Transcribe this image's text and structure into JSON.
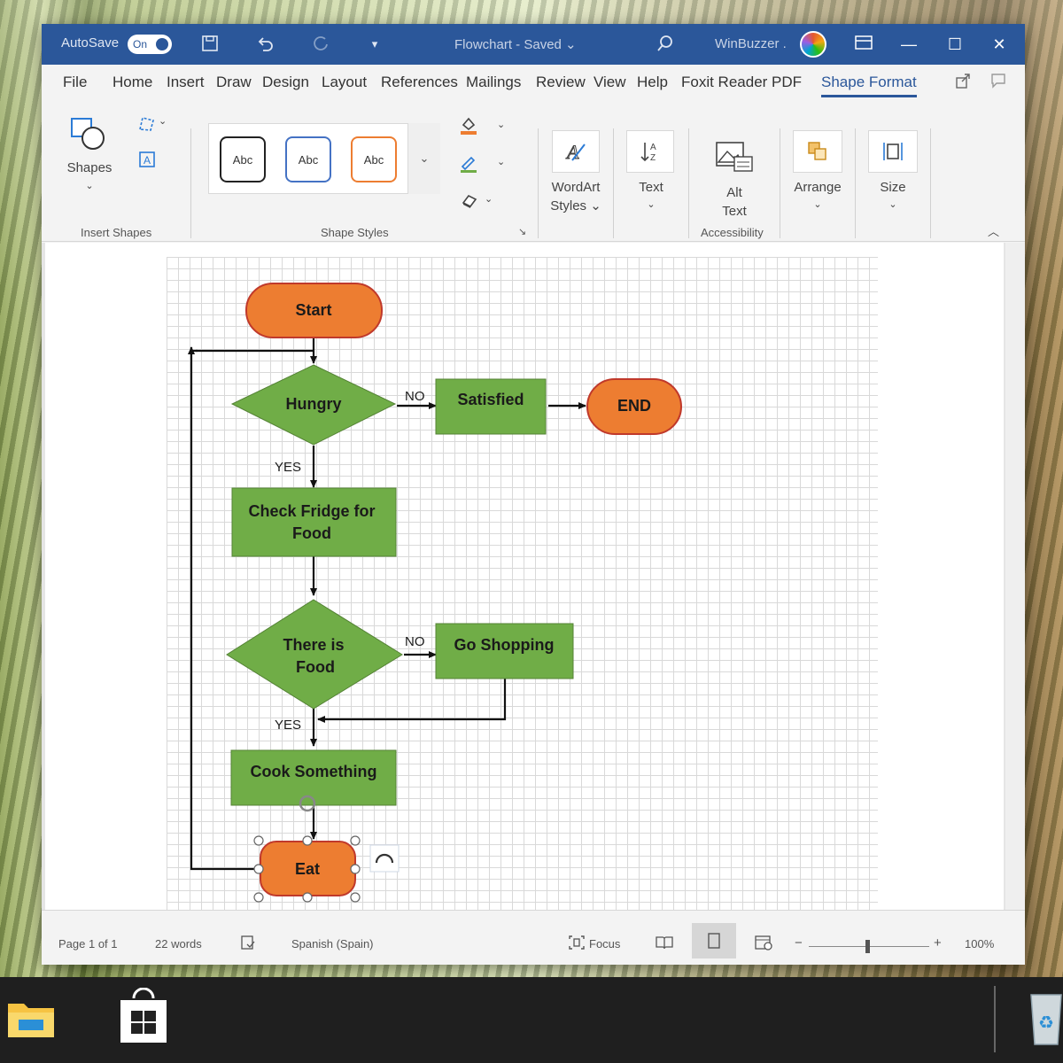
{
  "titlebar": {
    "autosave_label": "AutoSave",
    "autosave_state": "On",
    "document_title": "Flowchart - Saved ⌄",
    "user_name": "WinBuzzer .",
    "accent": "#2b579a"
  },
  "tabs": [
    "File",
    "Home",
    "Insert",
    "Draw",
    "Design",
    "Layout",
    "References",
    "Mailings",
    "Review",
    "View",
    "Help",
    "Foxit Reader PDF",
    "Shape Format"
  ],
  "active_tab": "Shape Format",
  "ribbon": {
    "insert_shapes": {
      "shapes_label": "Shapes",
      "group_label": "Insert Shapes"
    },
    "shape_styles": {
      "swatches": [
        "Abc",
        "Abc",
        "Abc"
      ],
      "group_label": "Shape Styles"
    },
    "wordart_label_1": "WordArt",
    "wordart_label_2": "Styles ⌄",
    "text_label": "Text",
    "alt_text_label_1": "Alt",
    "alt_text_label_2": "Text",
    "accessibility_group_label": "Accessibility",
    "arrange_label": "Arrange",
    "size_label": "Size"
  },
  "flowchart": {
    "nodes": {
      "start": "Start",
      "hungry": "Hungry",
      "satisfied": "Satisfied",
      "end": "END",
      "check_fridge_line1": "Check Fridge for",
      "check_fridge_line2": "Food",
      "there_is_line1": "There is",
      "there_is_line2": "Food",
      "go_shopping": "Go Shopping",
      "cook": "Cook Something",
      "eat": "Eat"
    },
    "edge_labels": {
      "hungry_no": "NO",
      "hungry_yes": "YES",
      "food_no": "NO",
      "food_yes": "YES"
    },
    "colors": {
      "terminal_fill": "#ed7d31",
      "terminal_stroke": "#c0392b",
      "process_fill": "#70ad47",
      "process_stroke": "#548235"
    }
  },
  "statusbar": {
    "page": "Page 1 of 1",
    "words": "22 words",
    "language": "Spanish (Spain)",
    "focus": "Focus",
    "zoom": "100%"
  }
}
